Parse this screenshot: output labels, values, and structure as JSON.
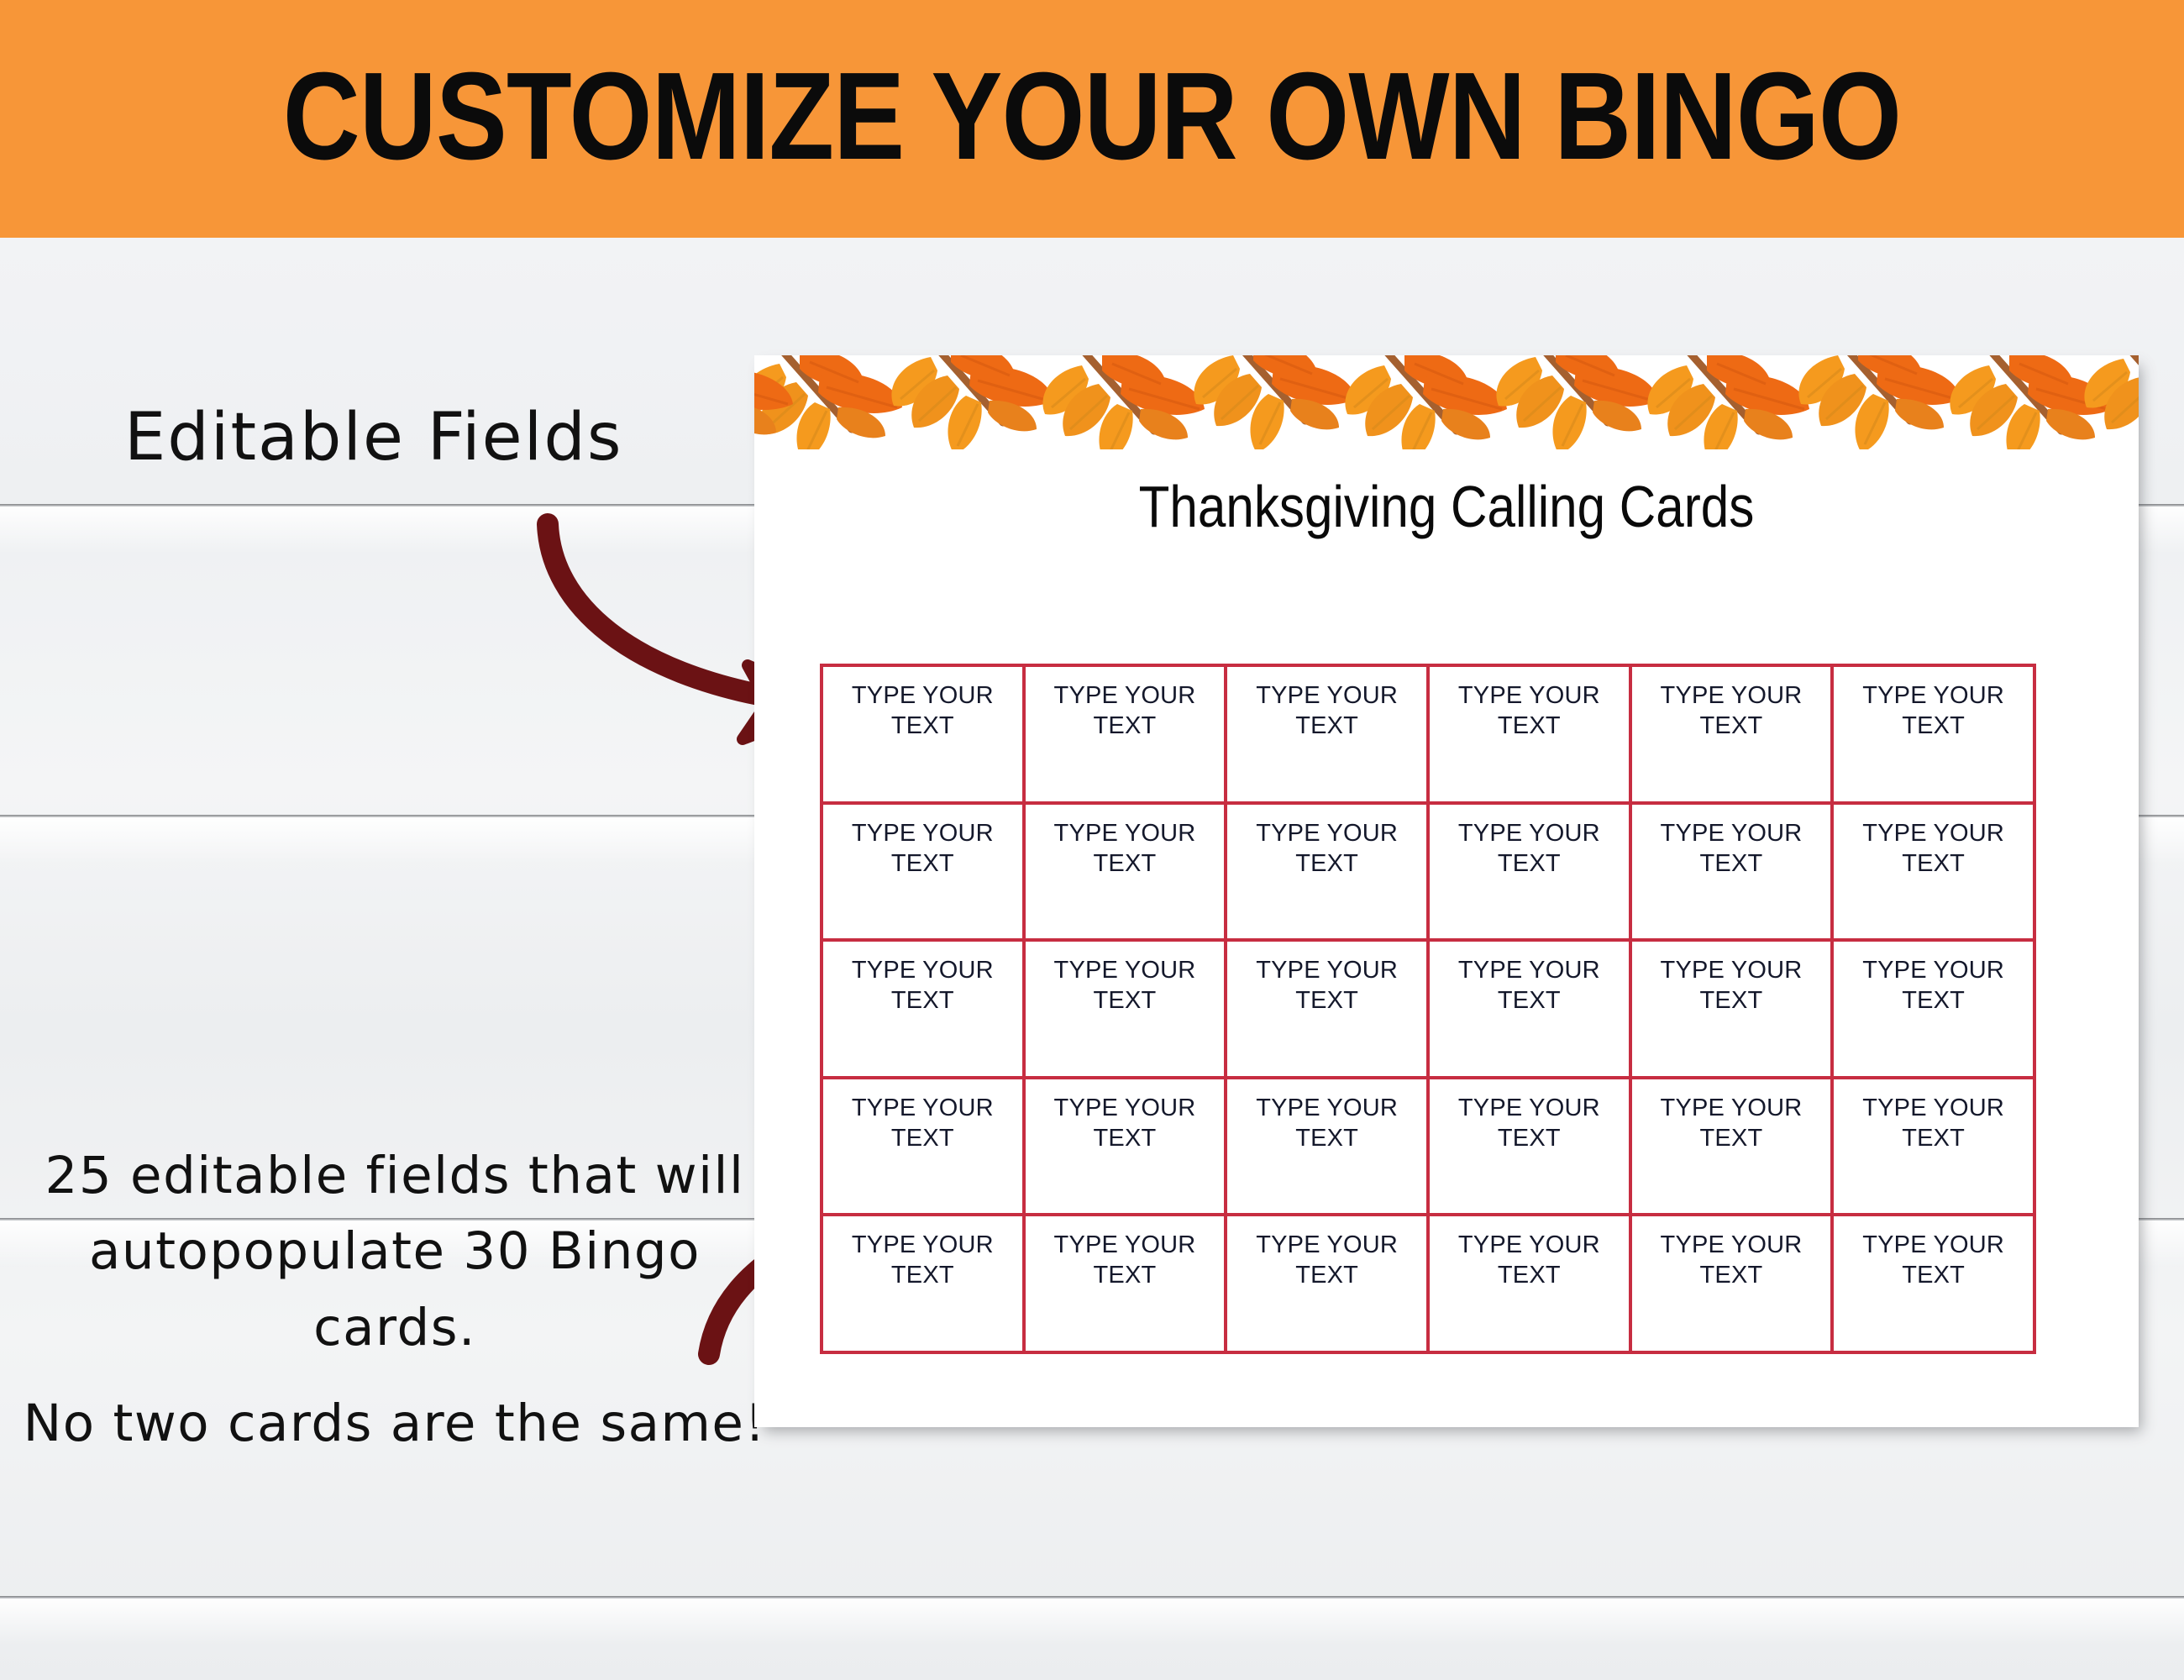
{
  "banner": {
    "title": "CUSTOMIZE YOUR OWN BINGO",
    "background_color": "#F79638",
    "text_color": "#0B0B0B"
  },
  "annotations": {
    "editable_fields_label": "Editable Fields",
    "description_lines": [
      "25 editable fields that will",
      "autopopulate 30 Bingo",
      "cards.",
      "No two cards are the same!"
    ],
    "arrow_color": "#6B1214",
    "arrow_top_name": "curved-arrow-to-first-cell",
    "arrow_bottom_name": "curved-arrow-to-grid"
  },
  "card": {
    "title": "Thanksgiving Calling Cards",
    "background_color": "#FFFFFF",
    "leaf_border": {
      "name": "autumn-leaves-border",
      "colors": [
        "#F59A1E",
        "#EE6A14",
        "#E8811C",
        "#A5602F"
      ],
      "leaf_cluster_count": 9
    },
    "grid": {
      "columns": 6,
      "rows": 5,
      "cell_count": 30,
      "border_color": "#C72D41",
      "cell_label": "TYPE YOUR\nTEXT",
      "cells": [
        "TYPE YOUR\nTEXT",
        "TYPE YOUR\nTEXT",
        "TYPE YOUR\nTEXT",
        "TYPE YOUR\nTEXT",
        "TYPE YOUR\nTEXT",
        "TYPE YOUR\nTEXT",
        "TYPE YOUR\nTEXT",
        "TYPE YOUR\nTEXT",
        "TYPE YOUR\nTEXT",
        "TYPE YOUR\nTEXT",
        "TYPE YOUR\nTEXT",
        "TYPE YOUR\nTEXT",
        "TYPE YOUR\nTEXT",
        "TYPE YOUR\nTEXT",
        "TYPE YOUR\nTEXT",
        "TYPE YOUR\nTEXT",
        "TYPE YOUR\nTEXT",
        "TYPE YOUR\nTEXT",
        "TYPE YOUR\nTEXT",
        "TYPE YOUR\nTEXT",
        "TYPE YOUR\nTEXT",
        "TYPE YOUR\nTEXT",
        "TYPE YOUR\nTEXT",
        "TYPE YOUR\nTEXT",
        "TYPE YOUR\nTEXT",
        "TYPE YOUR\nTEXT",
        "TYPE YOUR\nTEXT",
        "TYPE YOUR\nTEXT",
        "TYPE YOUR\nTEXT",
        "TYPE YOUR\nTEXT"
      ]
    }
  },
  "background": {
    "style_name": "white-shiplap-wood",
    "base_color": "#F1F2F4"
  }
}
